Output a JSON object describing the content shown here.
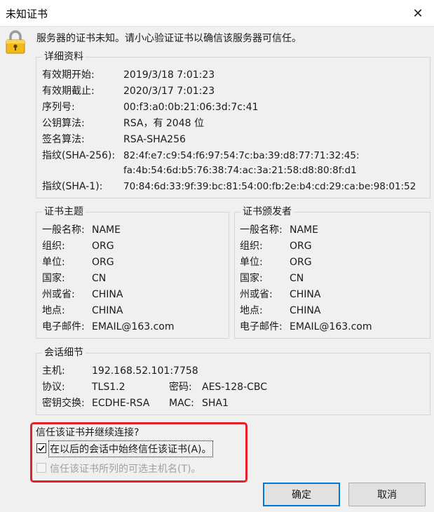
{
  "window": {
    "title": "未知证书",
    "close_glyph": "✕"
  },
  "warning": {
    "icon": "lock-icon",
    "text": "服务器的证书未知。请小心验证证书以确信该服务器可信任。"
  },
  "details": {
    "title": "详细资料",
    "rows": [
      {
        "label": "有效期开始:",
        "value": "2019/3/18 7:01:23"
      },
      {
        "label": "有效期截止:",
        "value": "2020/3/17 7:01:23"
      },
      {
        "label": "序列号:",
        "value": "00:f3:a0:0b:21:06:3d:7c:41"
      },
      {
        "label": "公钥算法:",
        "value": "RSA，有 2048 位"
      },
      {
        "label": "签名算法:",
        "value": "RSA-SHA256"
      }
    ],
    "sha256_label": "指纹(SHA-256):",
    "sha256_line1": "82:4f:e7:c9:54:f6:97:54:7c:ba:39:d8:77:71:32:45:",
    "sha256_line2": "fa:4b:54:6d:b5:76:38:74:ac:3a:21:58:d8:80:8f:d1",
    "sha1_label": "指纹(SHA-1):",
    "sha1_value": "70:84:6d:33:9f:39:bc:81:54:00:fb:2e:b4:cd:29:ca:be:98:01:52"
  },
  "subject": {
    "title": "证书主题",
    "rows": [
      {
        "label": "一般名称:",
        "value": "NAME"
      },
      {
        "label": "组织:",
        "value": "ORG"
      },
      {
        "label": "单位:",
        "value": "ORG"
      },
      {
        "label": "国家:",
        "value": "CN"
      },
      {
        "label": "州或省:",
        "value": "CHINA"
      },
      {
        "label": "地点:",
        "value": "CHINA"
      },
      {
        "label": "电子邮件:",
        "value": "EMAIL@163.com"
      }
    ]
  },
  "issuer": {
    "title": "证书颁发者",
    "rows": [
      {
        "label": "一般名称:",
        "value": "NAME"
      },
      {
        "label": "组织:",
        "value": "ORG"
      },
      {
        "label": "单位:",
        "value": "ORG"
      },
      {
        "label": "国家:",
        "value": "CN"
      },
      {
        "label": "州或省:",
        "value": "CHINA"
      },
      {
        "label": "地点:",
        "value": "CHINA"
      },
      {
        "label": "电子邮件:",
        "value": "EMAIL@163.com"
      }
    ]
  },
  "session": {
    "title": "会话细节",
    "host_label": "主机:",
    "host_value": "192.168.52.101:7758",
    "protocol_label": "协议:",
    "protocol_value": "TLS1.2",
    "cipher_label": "密码:",
    "cipher_value": "AES-128-CBC",
    "kex_label": "密钥交换:",
    "kex_value": "ECDHE-RSA",
    "mac_label": "MAC:",
    "mac_value": "SHA1"
  },
  "trust": {
    "question": "信任该证书并继续连接?",
    "always_trust": {
      "label": "在以后的会话中始终信任该证书(A)。",
      "checked": true
    },
    "trust_alt_names": {
      "label": "信任该证书所列的可选主机名(T)。",
      "checked": false,
      "disabled": true
    },
    "highlight_color": "#e8202a"
  },
  "buttons": {
    "ok": "确定",
    "cancel": "取消"
  }
}
